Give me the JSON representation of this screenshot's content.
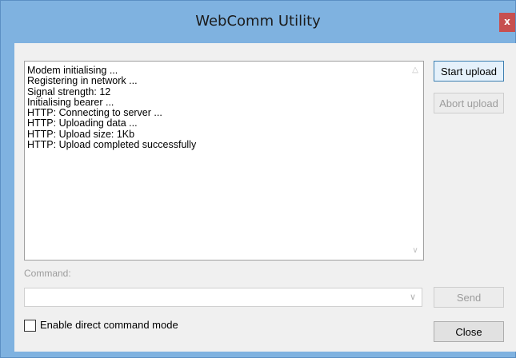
{
  "window": {
    "title": "WebComm Utility",
    "close_label": "x"
  },
  "log": {
    "lines": [
      "Modem initialising ...",
      "Registering in network ...",
      "Signal strength: 12",
      "Initialising bearer ...",
      "HTTP: Connecting to server ...",
      "HTTP: Uploading data ...",
      "HTTP: Upload size: 1Kb",
      "HTTP: Upload completed successfully"
    ],
    "scroll_up_icon": "chevron-up-icon",
    "scroll_down_icon": "chevron-down-icon"
  },
  "buttons": {
    "start_upload": "Start upload",
    "abort_upload": "Abort upload",
    "send": "Send",
    "close": "Close"
  },
  "command": {
    "label": "Command:",
    "value": ""
  },
  "options": {
    "direct_mode_label": "Enable direct command mode",
    "direct_mode_checked": false
  },
  "colors": {
    "titlebar": "#7fb2e0",
    "close_button": "#c75050"
  }
}
